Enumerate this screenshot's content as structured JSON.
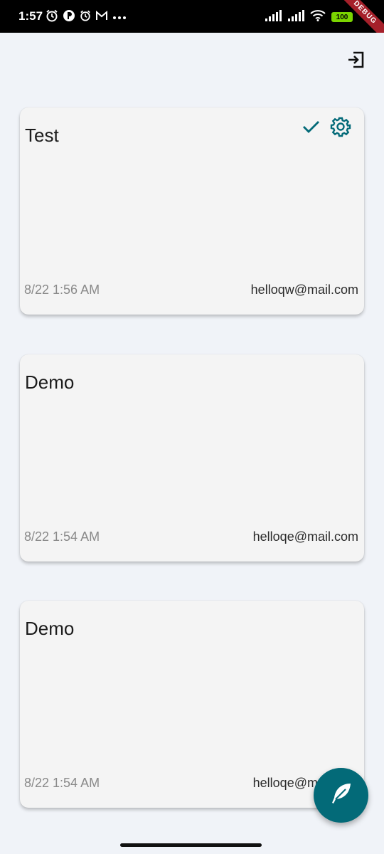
{
  "status_bar": {
    "time": "1:57",
    "battery": "100",
    "debug_label": "DEBUG"
  },
  "header": {
    "logout_icon": "logout-icon"
  },
  "notes": [
    {
      "title": "Test",
      "date": "8/22 1:56 AM",
      "email": "helloqw@mail.com",
      "show_actions": true
    },
    {
      "title": "Demo",
      "date": "8/22 1:54 AM",
      "email": "helloqe@mail.com",
      "show_actions": false
    },
    {
      "title": "Demo",
      "date": "8/22 1:54 AM",
      "email": "helloqe@mail.com",
      "show_actions": false
    }
  ],
  "fab": {
    "icon": "feather-icon"
  },
  "colors": {
    "accent": "#036a78",
    "background": "#f0f3f8",
    "card": "#f4f4f4"
  }
}
